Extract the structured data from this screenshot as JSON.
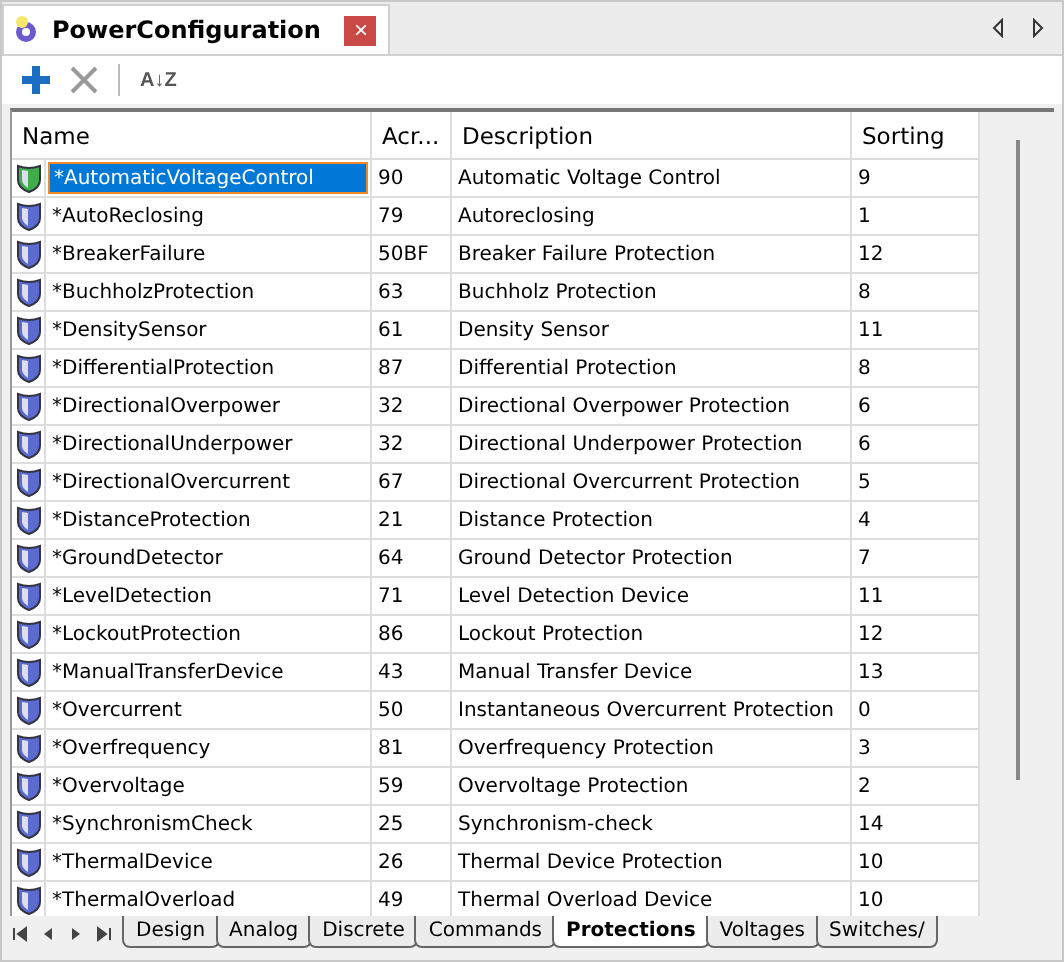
{
  "document_tab": {
    "title": "PowerConfiguration",
    "close": "×"
  },
  "toolbar": {
    "sort_label": "A↓Z"
  },
  "table": {
    "columns": [
      "Name",
      "Acr...",
      "Description",
      "Sorting"
    ],
    "rows": [
      {
        "name": "*AutomaticVoltageControl",
        "acronym": "90",
        "description": "Automatic Voltage Control",
        "sorting": "9",
        "selected": true
      },
      {
        "name": "*AutoReclosing",
        "acronym": "79",
        "description": "Autoreclosing",
        "sorting": "1",
        "selected": false
      },
      {
        "name": "*BreakerFailure",
        "acronym": "50BF",
        "description": "Breaker Failure Protection",
        "sorting": "12",
        "selected": false
      },
      {
        "name": "*BuchholzProtection",
        "acronym": "63",
        "description": "Buchholz Protection",
        "sorting": "8",
        "selected": false
      },
      {
        "name": "*DensitySensor",
        "acronym": "61",
        "description": "Density Sensor",
        "sorting": "11",
        "selected": false
      },
      {
        "name": "*DifferentialProtection",
        "acronym": "87",
        "description": "Differential Protection",
        "sorting": "8",
        "selected": false
      },
      {
        "name": "*DirectionalOverpower",
        "acronym": "32",
        "description": "Directional Overpower Protection",
        "sorting": "6",
        "selected": false
      },
      {
        "name": "*DirectionalUnderpower",
        "acronym": "32",
        "description": "Directional Underpower Protection",
        "sorting": "6",
        "selected": false
      },
      {
        "name": "*DirectionalOvercurrent",
        "acronym": "67",
        "description": "Directional Overcurrent Protection",
        "sorting": "5",
        "selected": false
      },
      {
        "name": "*DistanceProtection",
        "acronym": "21",
        "description": "Distance Protection",
        "sorting": "4",
        "selected": false
      },
      {
        "name": "*GroundDetector",
        "acronym": "64",
        "description": "Ground Detector Protection",
        "sorting": "7",
        "selected": false
      },
      {
        "name": "*LevelDetection",
        "acronym": "71",
        "description": "Level Detection Device",
        "sorting": "11",
        "selected": false
      },
      {
        "name": "*LockoutProtection",
        "acronym": "86",
        "description": "Lockout Protection",
        "sorting": "12",
        "selected": false
      },
      {
        "name": "*ManualTransferDevice",
        "acronym": "43",
        "description": "Manual Transfer Device",
        "sorting": "13",
        "selected": false
      },
      {
        "name": "*Overcurrent",
        "acronym": "50",
        "description": "Instantaneous Overcurrent Protection",
        "sorting": "0",
        "selected": false
      },
      {
        "name": "*Overfrequency",
        "acronym": "81",
        "description": "Overfrequency Protection",
        "sorting": "3",
        "selected": false
      },
      {
        "name": "*Overvoltage",
        "acronym": "59",
        "description": "Overvoltage Protection",
        "sorting": "2",
        "selected": false
      },
      {
        "name": "*SynchronismCheck",
        "acronym": "25",
        "description": "Synchronism-check",
        "sorting": "14",
        "selected": false
      },
      {
        "name": "*ThermalDevice",
        "acronym": "26",
        "description": "Thermal Device Protection",
        "sorting": "10",
        "selected": false
      },
      {
        "name": "*ThermalOverload",
        "acronym": "49",
        "description": "Thermal Overload Device",
        "sorting": "10",
        "selected": false
      }
    ]
  },
  "sheet_tabs": [
    {
      "label": "Design",
      "selected": false
    },
    {
      "label": "Analog",
      "selected": false
    },
    {
      "label": "Discrete",
      "selected": false
    },
    {
      "label": "Commands",
      "selected": false
    },
    {
      "label": "Protections",
      "selected": true
    },
    {
      "label": "Voltages",
      "selected": false
    },
    {
      "label": "Switches/",
      "selected": false
    }
  ]
}
